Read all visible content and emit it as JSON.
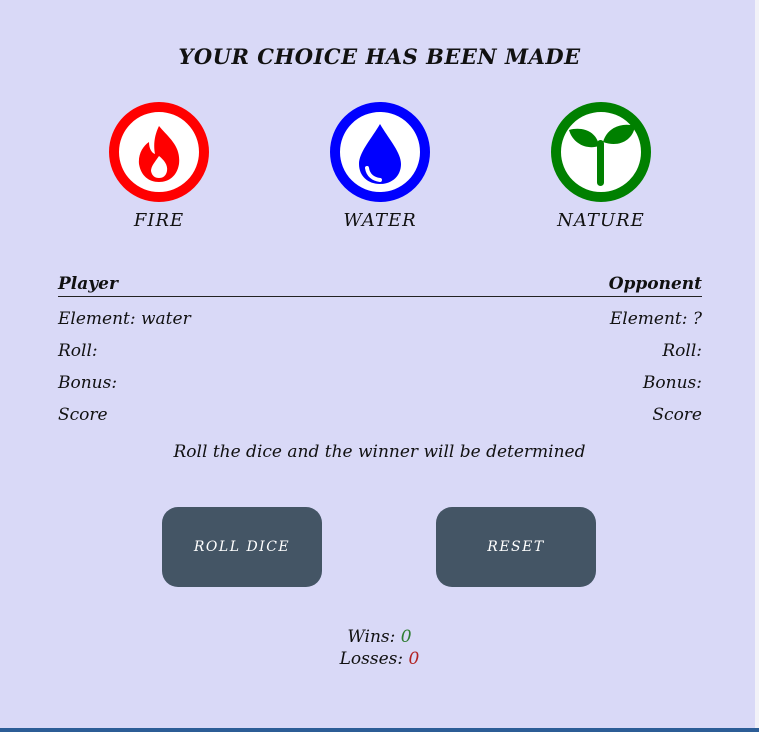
{
  "title": "YOUR CHOICE HAS BEEN MADE",
  "elements": [
    {
      "label": "FIRE",
      "color": "#ff0000",
      "icon": "flame-icon"
    },
    {
      "label": "WATER",
      "color": "#0000ff",
      "icon": "water-drop-icon"
    },
    {
      "label": "NATURE",
      "color": "#008000",
      "icon": "sprout-icon"
    }
  ],
  "stats": {
    "player_header": "Player",
    "opponent_header": "Opponent",
    "player": {
      "element": "Element: water",
      "roll": "Roll:",
      "bonus": "Bonus:",
      "score": "Score"
    },
    "opponent": {
      "element": "Element: ?",
      "roll": "Roll:",
      "bonus": "Bonus:",
      "score": "Score"
    }
  },
  "message": "Roll the dice and the winner will be determined",
  "buttons": {
    "roll": "ROLL DICE",
    "reset": "RESET"
  },
  "record": {
    "wins_label": "Wins:",
    "wins": "0",
    "losses_label": "Losses:",
    "losses": "0"
  }
}
